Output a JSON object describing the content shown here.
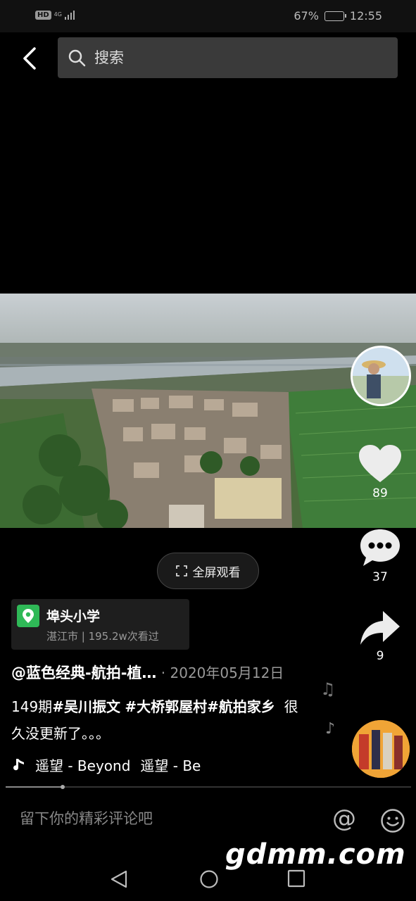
{
  "status_bar": {
    "hd": "HD",
    "network": "4G",
    "battery_percent": "67%",
    "battery_level": 0.67,
    "time": "12:55"
  },
  "top_bar": {
    "search_placeholder": "搜索"
  },
  "video": {
    "fullscreen_label": "全屏观看"
  },
  "actions": {
    "likes": "89",
    "comments": "37",
    "shares": "9"
  },
  "location": {
    "name": "埠头小学",
    "subtitle": "湛江市 | 195.2w次看过"
  },
  "post": {
    "author": "@蓝色经典-航拍-植…",
    "date": " · 2020年05月12日",
    "desc_prefix": "149期",
    "tags": [
      "#吴川振文",
      "#大桥郭屋村",
      "#航拍家乡"
    ],
    "desc_text": "很久没更新了。。。"
  },
  "music": {
    "track_1": "遥望 - Beyond",
    "track_2": "遥望 - Be",
    "progress": 0.14
  },
  "comment": {
    "placeholder": "留下你的精彩评论吧"
  },
  "watermark": "gdmm.com",
  "icons": {
    "back": "chevron-left-icon",
    "search": "search-icon",
    "like": "heart-icon",
    "comment": "speech-bubble-icon",
    "share": "share-arrow-icon",
    "fullscreen": "fullscreen-icon",
    "location": "location-pin-icon",
    "music": "music-note-icon",
    "at": "at-icon",
    "emoji": "emoji-icon"
  },
  "colors": {
    "background": "#000000",
    "location_pin": "#2fb957",
    "search_box": "#3a3a3a"
  }
}
